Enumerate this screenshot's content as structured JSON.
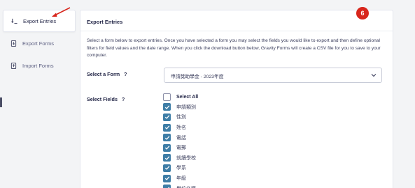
{
  "sidebar": {
    "items": [
      {
        "label": "Export Entries",
        "icon": "export-entries-icon",
        "active": true
      },
      {
        "label": "Export Forms",
        "icon": "export-forms-icon",
        "active": false
      },
      {
        "label": "Import Forms",
        "icon": "import-forms-icon",
        "active": false
      }
    ]
  },
  "annotation": {
    "step_number": "6",
    "color": "#d8261c"
  },
  "panel": {
    "title": "Export Entries",
    "description": "Select a form below to export entries. Once you have selected a form you may select the fields you would like to export and then define optional filters for field values and the date range. When you click the download button below, Gravity Forms will create a CSV file for you to save to your computer.",
    "select_form": {
      "label": "Select a Form",
      "help": "?",
      "value": "申請獎助學金 - 2023年度"
    },
    "select_fields": {
      "label": "Select Fields",
      "help": "?",
      "select_all_label": "Select All",
      "select_all_checked": false,
      "fields": [
        {
          "label": "申請類別",
          "checked": true
        },
        {
          "label": "性別",
          "checked": true
        },
        {
          "label": "姓名",
          "checked": true
        },
        {
          "label": "電話",
          "checked": true
        },
        {
          "label": "電郵",
          "checked": true
        },
        {
          "label": "就讀學校",
          "checked": true
        },
        {
          "label": "學系",
          "checked": true
        },
        {
          "label": "年級",
          "checked": true
        },
        {
          "label": "學位名稱",
          "checked": true
        }
      ]
    }
  },
  "colors": {
    "accent": "#3e7da6",
    "panel_bg": "#ffffff",
    "page_bg": "#f3f4f6"
  }
}
